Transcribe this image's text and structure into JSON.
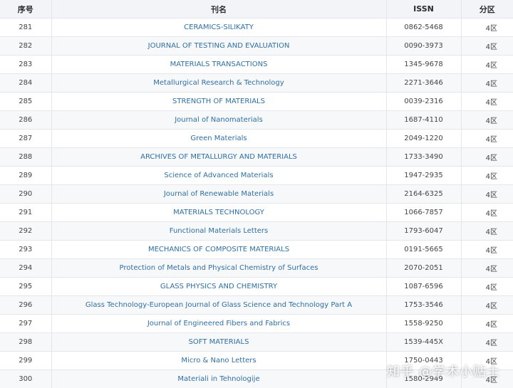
{
  "headers": {
    "no": "序号",
    "name": "刊名",
    "issn": "ISSN",
    "zone": "分区"
  },
  "rows": [
    {
      "no": "281",
      "name": "CERAMICS-SILIKATY",
      "issn": "0862-5468",
      "zone": "4区"
    },
    {
      "no": "282",
      "name": "JOURNAL OF TESTING AND EVALUATION",
      "issn": "0090-3973",
      "zone": "4区"
    },
    {
      "no": "283",
      "name": "MATERIALS TRANSACTIONS",
      "issn": "1345-9678",
      "zone": "4区"
    },
    {
      "no": "284",
      "name": "Metallurgical Research & Technology",
      "issn": "2271-3646",
      "zone": "4区"
    },
    {
      "no": "285",
      "name": "STRENGTH OF MATERIALS",
      "issn": "0039-2316",
      "zone": "4区"
    },
    {
      "no": "286",
      "name": "Journal of Nanomaterials",
      "issn": "1687-4110",
      "zone": "4区"
    },
    {
      "no": "287",
      "name": "Green Materials",
      "issn": "2049-1220",
      "zone": "4区"
    },
    {
      "no": "288",
      "name": "ARCHIVES OF METALLURGY AND MATERIALS",
      "issn": "1733-3490",
      "zone": "4区"
    },
    {
      "no": "289",
      "name": "Science of Advanced Materials",
      "issn": "1947-2935",
      "zone": "4区"
    },
    {
      "no": "290",
      "name": "Journal of Renewable Materials",
      "issn": "2164-6325",
      "zone": "4区"
    },
    {
      "no": "291",
      "name": "MATERIALS TECHNOLOGY",
      "issn": "1066-7857",
      "zone": "4区"
    },
    {
      "no": "292",
      "name": "Functional Materials Letters",
      "issn": "1793-6047",
      "zone": "4区"
    },
    {
      "no": "293",
      "name": "MECHANICS OF COMPOSITE MATERIALS",
      "issn": "0191-5665",
      "zone": "4区"
    },
    {
      "no": "294",
      "name": "Protection of Metals and Physical Chemistry of Surfaces",
      "issn": "2070-2051",
      "zone": "4区"
    },
    {
      "no": "295",
      "name": "GLASS PHYSICS AND CHEMISTRY",
      "issn": "1087-6596",
      "zone": "4区"
    },
    {
      "no": "296",
      "name": "Glass Technology-European Journal of Glass Science and Technology Part A",
      "issn": "1753-3546",
      "zone": "4区"
    },
    {
      "no": "297",
      "name": "Journal of Engineered Fibers and Fabrics",
      "issn": "1558-9250",
      "zone": "4区"
    },
    {
      "no": "298",
      "name": "SOFT MATERIALS",
      "issn": "1539-445X",
      "zone": "4区"
    },
    {
      "no": "299",
      "name": "Micro & Nano Letters",
      "issn": "1750-0443",
      "zone": "4区"
    },
    {
      "no": "300",
      "name": "Materiali in Tehnologije",
      "issn": "1580-2949",
      "zone": "4区"
    }
  ],
  "watermark": "知乎 @学术小贴士"
}
